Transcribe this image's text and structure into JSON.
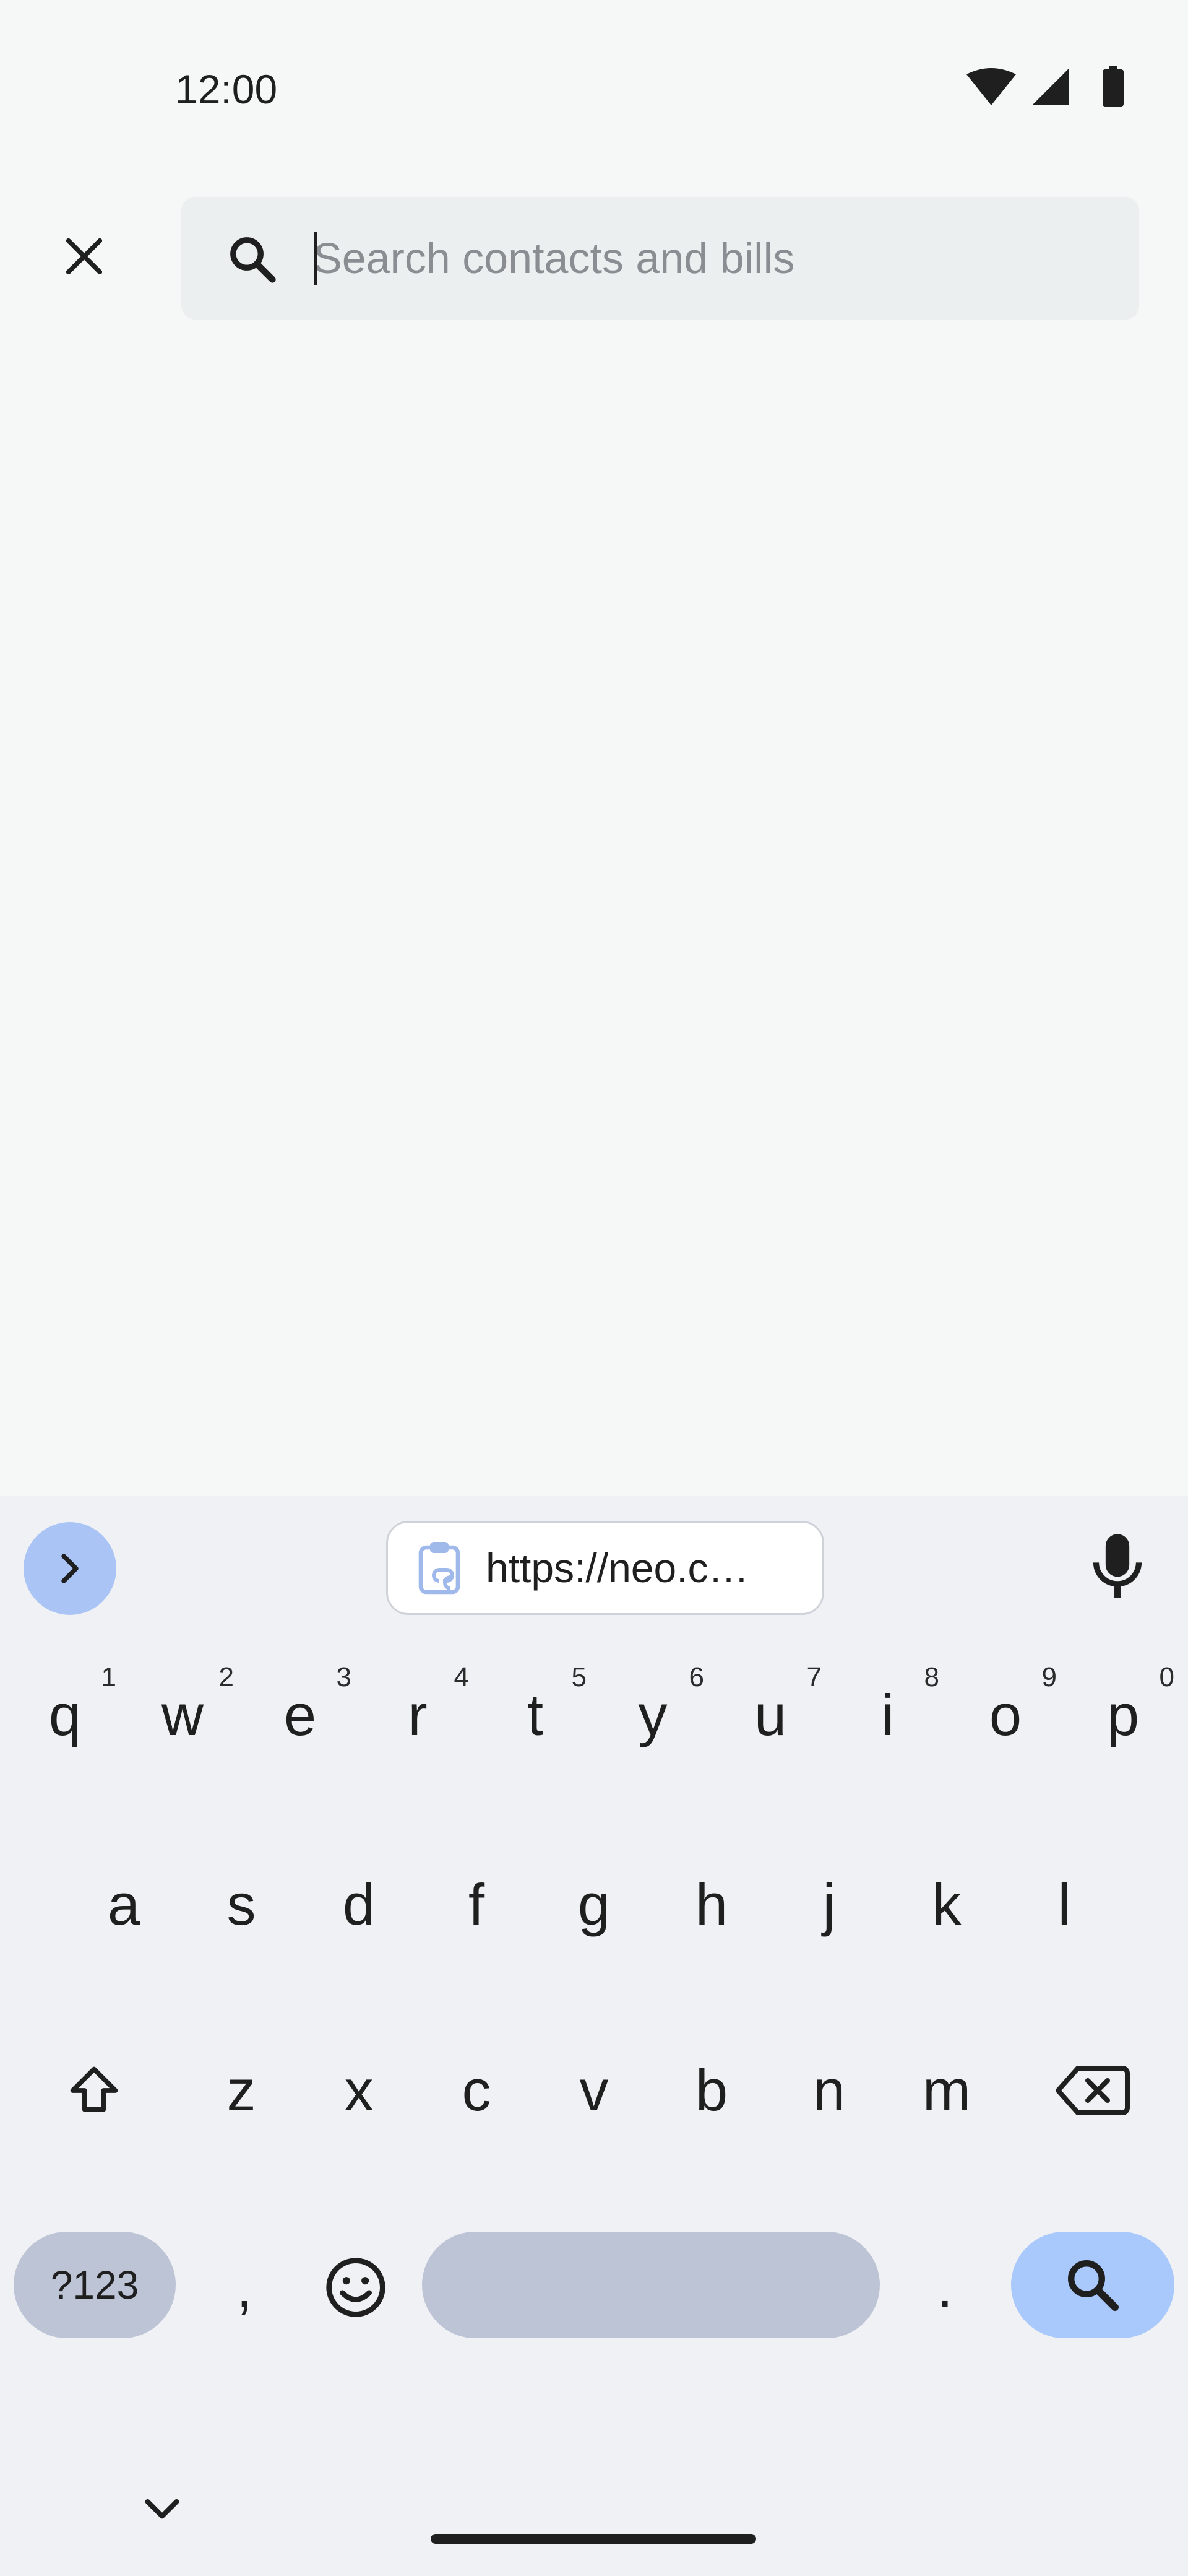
{
  "status_bar": {
    "time": "12:00",
    "icons": [
      "wifi-icon",
      "cellular-signal-icon",
      "battery-icon"
    ]
  },
  "app_bar": {
    "close_icon": "close-icon",
    "search": {
      "icon": "search-icon",
      "placeholder": "Search contacts and bills",
      "value": ""
    }
  },
  "keyboard": {
    "toolbar": {
      "expand_icon": "chevron-right-icon",
      "clipboard_icon": "clipboard-link-icon",
      "clipboard_text": "https://neo.c…",
      "mic_icon": "microphone-icon"
    },
    "row1": [
      {
        "key": "q",
        "hint": "1"
      },
      {
        "key": "w",
        "hint": "2"
      },
      {
        "key": "e",
        "hint": "3"
      },
      {
        "key": "r",
        "hint": "4"
      },
      {
        "key": "t",
        "hint": "5"
      },
      {
        "key": "y",
        "hint": "6"
      },
      {
        "key": "u",
        "hint": "7"
      },
      {
        "key": "i",
        "hint": "8"
      },
      {
        "key": "o",
        "hint": "9"
      },
      {
        "key": "p",
        "hint": "0"
      }
    ],
    "row2": [
      "a",
      "s",
      "d",
      "f",
      "g",
      "h",
      "j",
      "k",
      "l"
    ],
    "row3": [
      "z",
      "x",
      "c",
      "v",
      "b",
      "n",
      "m"
    ],
    "shift_icon": "shift-icon",
    "backspace_icon": "backspace-icon",
    "symbols_label": "?123",
    "comma_label": ",",
    "emoji_icon": "emoji-icon",
    "period_label": ".",
    "action_icon": "search-icon",
    "hide_icon": "chevron-down-icon"
  },
  "colors": {
    "background": "#f6f8f8",
    "search_field": "#eceff0",
    "keyboard_bg": "#f0f1f4",
    "accent_key": "#a9c8fb",
    "special_key": "#bcc4d6"
  }
}
